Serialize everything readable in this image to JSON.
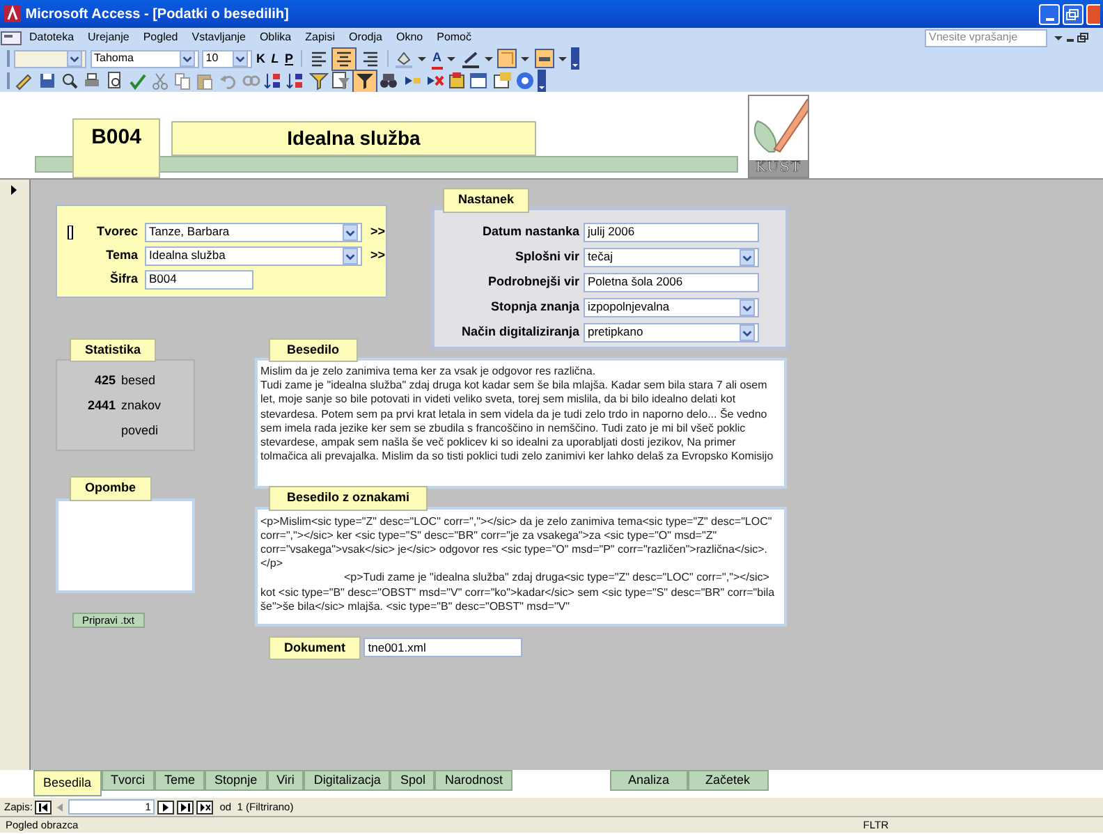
{
  "window": {
    "title": "Microsoft Access - [Podatki o besedilih]"
  },
  "menu": [
    "Datoteka",
    "Urejanje",
    "Pogled",
    "Vstavljanje",
    "Oblika",
    "Zapisi",
    "Orodja",
    "Okno",
    "Pomoč"
  ],
  "help_box": {
    "placeholder": "Vnesite vprašanje"
  },
  "format_toolbar": {
    "font": "Tahoma",
    "size": "10",
    "bold": "K",
    "italic": "L",
    "underline": "P",
    "font_color": "A",
    "alignments": [
      {
        "selected": false
      },
      {
        "selected": true
      },
      {
        "selected": false
      }
    ]
  },
  "main_toolbar": {
    "filter_applied": true
  },
  "header": {
    "code": "B004",
    "title": "Idealna služba",
    "logo_text": "KUST"
  },
  "author_box": {
    "fields": [
      {
        "label": "Tvorec",
        "value": "Tanze, Barbara",
        "kind": "combo",
        "more": ">>"
      },
      {
        "label": "Tema",
        "value": "Idealna služba",
        "kind": "combo",
        "more": ">>"
      },
      {
        "label": "Šifra",
        "value": "B004",
        "kind": "short"
      }
    ]
  },
  "origin": {
    "title": "Nastanek",
    "fields": [
      {
        "label": "Datum nastanka",
        "value": "julij 2006",
        "kind": "text"
      },
      {
        "label": "Splošni vir",
        "value": "tečaj",
        "kind": "combo"
      },
      {
        "label": "Podrobnejši vir",
        "value": "Poletna šola 2006",
        "kind": "text"
      },
      {
        "label": "Stopnja znanja",
        "value": "izpopolnjevalna",
        "kind": "combo"
      },
      {
        "label": "Način digitaliziranja",
        "value": "pretipkano",
        "kind": "combo"
      }
    ]
  },
  "stats": {
    "title": "Statistika",
    "rows": [
      {
        "count": "425",
        "unit": "besed"
      },
      {
        "count": "2441",
        "unit": "znakov"
      },
      {
        "unit": "povedi"
      }
    ]
  },
  "notes": {
    "title": "Opombe"
  },
  "prepare_button": "Pripravi .txt",
  "text": {
    "title": "Besedilo",
    "paragraphs": [
      "Mislim da je zelo zanimiva tema ker za vsak je odgovor res različna.",
      "Tudi zame je \"idealna služba\" zdaj druga kot kadar sem še bila mlajša. Kadar sem bila stara 7 ali osem let, moje sanje so bile potovati in videti veliko sveta, torej sem mislila, da bi bilo idealno delati kot stevardesa. Potem sem pa prvi krat letala in sem videla da je tudi zelo trdo in naporno delo... Še vedno sem imela rada jezike ker sem se zbudila s francoščino in nemščino. Tudi zato je mi bil všeč poklic stevardese, ampak sem našla še več poklicev ki so idealni za uporabljati dosti jezikov, Na primer tolmačica ali prevajalka. Mislim da so tisti poklici tudi zelo zanimivi ker lahko delaš za Evropsko Komisijo"
    ]
  },
  "tagged": {
    "title": "Besedilo z oznakami",
    "paragraphs": [
      "<p>Mislim<sic type=\"Z\" desc=\"LOC\" corr=\",\"></sic> da je zelo zanimiva tema<sic type=\"Z\" desc=\"LOC\" corr=\",\"></sic> ker <sic type=\"S\" desc=\"BR\" corr=\"je za vsakega\">za <sic type=\"O\" msd=\"Z\" corr=\"vsakega\">vsak</sic> je</sic> odgovor res <sic type=\"O\" msd=\"P\" corr=\"različen\">različna</sic>.</p>",
      "<p>Tudi zame je \"idealna služba\" zdaj druga<sic type=\"Z\" desc=\"LOC\" corr=\",\"></sic> kot <sic type=\"B\" desc=\"OBST\" msd=\"V\" corr=\"ko\">kadar</sic> sem <sic type=\"S\" desc=\"BR\" corr=\"bila še\">še bila</sic> mlajša. <sic type=\"B\" desc=\"OBST\" msd=\"V\""
    ]
  },
  "document": {
    "label": "Dokument",
    "value": "tne001.xml"
  },
  "tabs": [
    {
      "label": "Besedila",
      "selected": true
    },
    {
      "label": "Tvorci",
      "selected": false
    },
    {
      "label": "Teme",
      "selected": false
    },
    {
      "label": "Stopnje",
      "selected": false
    },
    {
      "label": "Viri",
      "selected": false
    },
    {
      "label": "Digitalizacja",
      "selected": false
    },
    {
      "label": "Spol",
      "selected": false
    },
    {
      "label": "Narodnost",
      "selected": false
    }
  ],
  "tabs_right": [
    {
      "label": "Analiza",
      "selected": false
    },
    {
      "label": "Začetek",
      "selected": false
    }
  ],
  "record_nav": {
    "label": "Zapis:",
    "current": "1",
    "of": "od",
    "total": "1 (Filtrirano)"
  },
  "status_bar": {
    "text": "Pogled obrazca",
    "mode": "FLTR"
  }
}
